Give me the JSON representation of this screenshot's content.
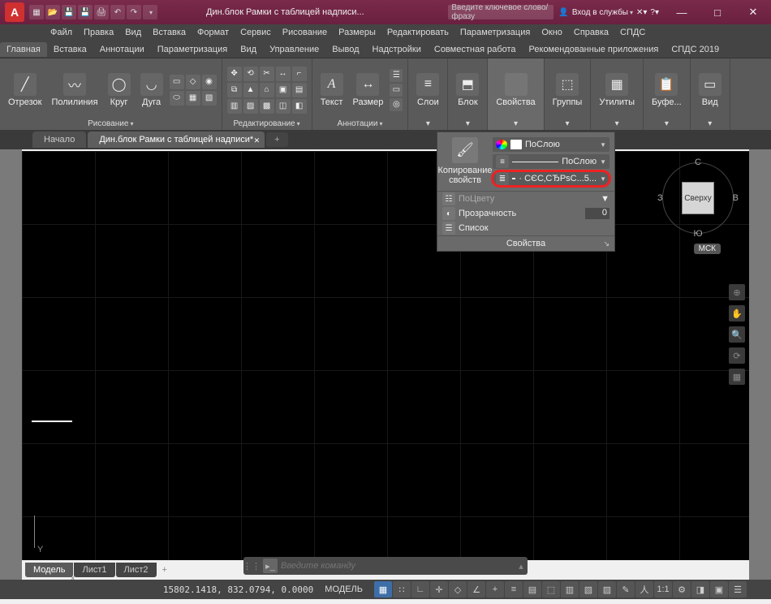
{
  "title": "Дин.блок Рамки с таблицей надписи...",
  "search_placeholder": "Введите ключевое слово/фразу",
  "signin": "Вход в службы",
  "menubar": [
    "Файл",
    "Правка",
    "Вид",
    "Вставка",
    "Формат",
    "Сервис",
    "Рисование",
    "Размеры",
    "Редактировать",
    "Параметризация",
    "Окно",
    "Справка",
    "СПДС"
  ],
  "ribbon_tabs": [
    "Главная",
    "Вставка",
    "Аннотации",
    "Параметризация",
    "Вид",
    "Управление",
    "Вывод",
    "Надстройки",
    "Совместная работа",
    "Рекомендованные приложения",
    "СПДС 2019"
  ],
  "active_ribbon_tab": 0,
  "panels": {
    "draw": {
      "label": "Рисование",
      "items": {
        "otrezok": "Отрезок",
        "polilinia": "Полилиния",
        "krug": "Круг",
        "duga": "Дуга"
      }
    },
    "edit": {
      "label": "Редактирование"
    },
    "annot": {
      "label": "Аннотации",
      "text": "Текст",
      "razmer": "Размер"
    },
    "sloi": {
      "label": "Слои"
    },
    "blok": {
      "label": "Блок"
    },
    "props": {
      "label": "Свойства"
    },
    "groups": {
      "label": "Группы"
    },
    "util": {
      "label": "Утилиты"
    },
    "buf": {
      "label": "Буфе..."
    },
    "vid": {
      "label": "Вид"
    }
  },
  "draw_tabs": [
    {
      "label": "Начало",
      "active": false
    },
    {
      "label": "Дин.блок Рамки с таблицей надписи*",
      "active": true
    }
  ],
  "prop_panel": {
    "copy_label": "Копирование свойств",
    "color_label": "ПоСлою",
    "lineweight_label": "ПоСлою",
    "linetype_label": "· СЄС‚СЂРѕС...5...",
    "plotstyle": "ПоЦвету",
    "transparency_label": "Прозрачность",
    "transparency_value": "0",
    "list": "Список",
    "footer": "Свойства"
  },
  "viewcube": {
    "face": "Сверху",
    "n": "С",
    "s": "Ю",
    "e": "В",
    "w": "З",
    "label": "МСК"
  },
  "cmd_placeholder": "Введите команду",
  "model_tabs": [
    "Модель",
    "Лист1",
    "Лист2"
  ],
  "active_model_tab": 0,
  "status": {
    "coords": "15802.1418, 832.0794, 0.0000",
    "model": "МОДЕЛЬ"
  }
}
